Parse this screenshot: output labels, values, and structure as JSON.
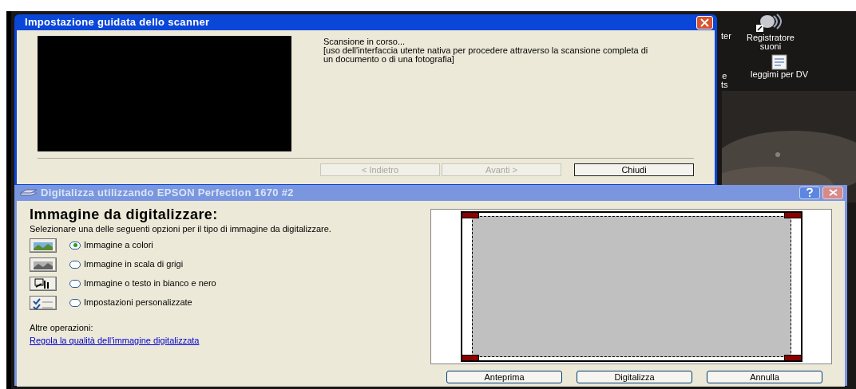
{
  "desktop_icons": [
    {
      "kind": "none",
      "lines": [
        "ter"
      ]
    },
    {
      "kind": "speaker",
      "lines": [
        "Registratore",
        "suoni"
      ]
    },
    {
      "kind": "none",
      "lines": [
        "e",
        "ts"
      ]
    },
    {
      "kind": "notepad",
      "lines": [
        "leggimi per DV"
      ]
    }
  ],
  "wizard": {
    "title": "Impostazione guidata dello scanner",
    "status": "Scansione in corso...",
    "description": "[uso dell'interfaccia utente nativa per procedere attraverso la scansione completa di un documento o di una fotografia]",
    "buttons": [
      {
        "label": "< Indietro",
        "disabled": true
      },
      {
        "label": "Avanti >",
        "disabled": true
      },
      {
        "label": "Chiudi",
        "disabled": false
      }
    ]
  },
  "scan_dialog": {
    "title": "Digitalizza utilizzando EPSON Perfection 1670 #2",
    "active": false,
    "heading": "Immagine da digitalizzare:",
    "instructions": "Selezionare una delle seguenti opzioni per il tipo di immagine da digitalizzare.",
    "options": [
      {
        "kind": "color",
        "label": "Immagine a colori",
        "selected": true
      },
      {
        "kind": "gray",
        "label": "Immagine in scala di grigi",
        "selected": false
      },
      {
        "kind": "bw",
        "label": "Immagine o testo in bianco e nero",
        "selected": false
      },
      {
        "kind": "custom",
        "label": "Impostazioni personalizzate",
        "selected": false
      }
    ],
    "other_label": "Altre operazioni:",
    "link": "Regola la qualità dell'immagine digitalizzata",
    "buttons": [
      {
        "label": "Anteprima"
      },
      {
        "label": "Digitalizza"
      },
      {
        "label": "Annulla"
      }
    ]
  }
}
